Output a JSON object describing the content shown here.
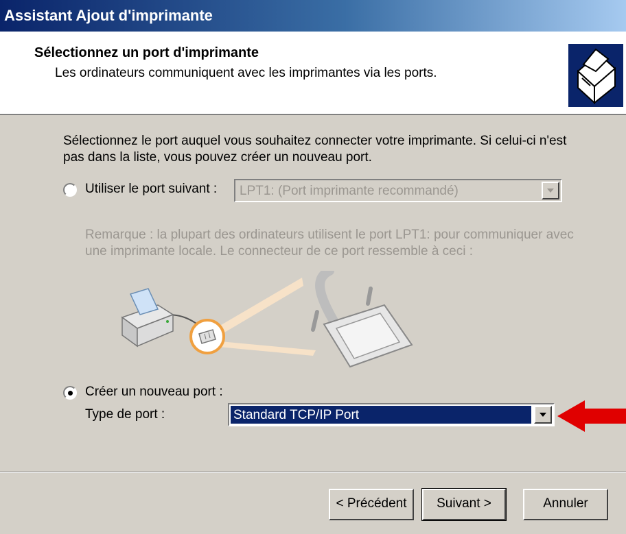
{
  "window": {
    "title": "Assistant Ajout d'imprimante"
  },
  "header": {
    "title": "Sélectionnez un port d'imprimante",
    "subtitle": "Les ordinateurs communiquent avec les imprimantes via les ports."
  },
  "intro": {
    "line1": "Sélectionnez le port auquel vous souhaitez connecter votre imprimante. Si celui-ci n'est",
    "line2": "pas dans la liste, vous pouvez créer un nouveau port."
  },
  "existing_port": {
    "label": "Utiliser le port suivant :",
    "selected": false,
    "value": "LPT1: (Port imprimante recommandé)"
  },
  "note": {
    "line1": "Remarque : la plupart des ordinateurs utilisent le port LPT1: pour communiquer avec",
    "line2": "une imprimante locale. Le connecteur de ce port ressemble à ceci :"
  },
  "new_port": {
    "label": "Créer un nouveau port :",
    "selected": true,
    "type_label": "Type de port :",
    "type_value": "Standard TCP/IP Port"
  },
  "buttons": {
    "back": "< Précédent",
    "next": "Suivant >",
    "cancel": "Annuler"
  },
  "colors": {
    "highlight": "#0a246a",
    "arrow": "#e00000",
    "title_gradient_start": "#0a246a",
    "title_gradient_end": "#a6caf0"
  }
}
